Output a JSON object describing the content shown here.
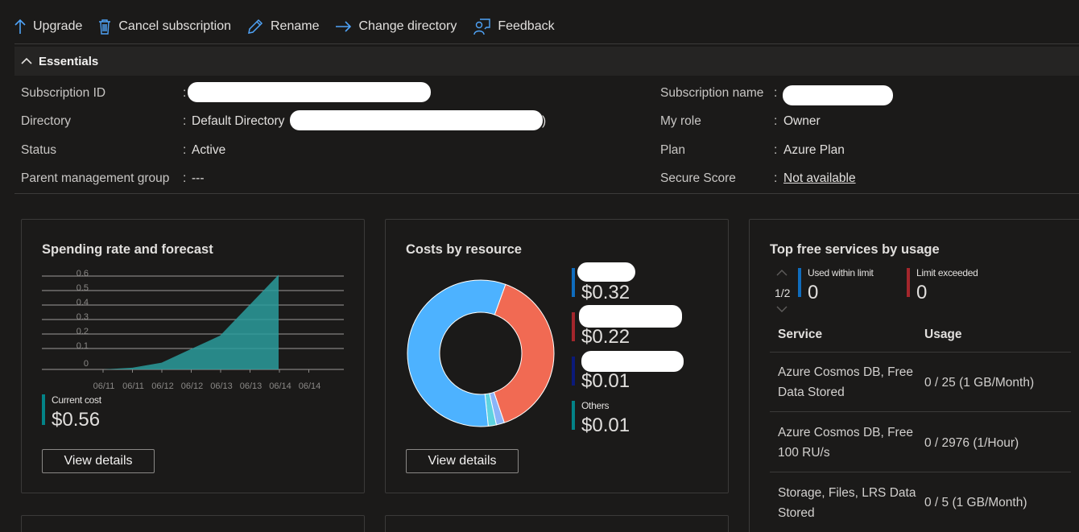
{
  "toolbar": {
    "upgrade": "Upgrade",
    "cancel": "Cancel subscription",
    "rename": "Rename",
    "change_directory": "Change directory",
    "feedback": "Feedback"
  },
  "essentials": {
    "title": "Essentials",
    "left": [
      {
        "key": "Subscription ID",
        "value": ""
      },
      {
        "key": "Directory",
        "value": "Default Directory",
        "suffix": ")"
      },
      {
        "key": "Status",
        "value": "Active"
      },
      {
        "key": "Parent management group",
        "value": "---"
      }
    ],
    "right": [
      {
        "key": "Subscription name",
        "value": ""
      },
      {
        "key": "My role",
        "value": "Owner"
      },
      {
        "key": "Plan",
        "value": "Azure Plan"
      },
      {
        "key": "Secure Score",
        "value": "Not available"
      }
    ]
  },
  "spending": {
    "title": "Spending rate and forecast",
    "current_cost_label": "Current cost",
    "current_cost": "$0.56",
    "button": "View details"
  },
  "costs": {
    "title": "Costs by resource",
    "legend": [
      {
        "name": "",
        "value": "$0.32",
        "color": "#0f6cbd"
      },
      {
        "name": "",
        "value": "$0.22",
        "color": "#a4262c"
      },
      {
        "name": "",
        "value": "$0.01",
        "color": "#0b1a7a"
      },
      {
        "name": "Others",
        "value": "$0.01",
        "color": "#038387"
      }
    ],
    "button": "View details"
  },
  "free_services": {
    "title": "Top free services by usage",
    "pager": "1/2",
    "used_label": "Used within limit",
    "used_value": "0",
    "exceeded_label": "Limit exceeded",
    "exceeded_value": "0",
    "col_service": "Service",
    "col_usage": "Usage",
    "rows": [
      {
        "service_line1": "Azure Cosmos DB, Free",
        "service_line2": "Data Stored",
        "usage": "0 / 25 (1 GB/Month)"
      },
      {
        "service_line1": "Azure Cosmos DB, Free",
        "service_line2": "100 RU/s",
        "usage": "0 / 2976 (1/Hour)"
      },
      {
        "service_line1": "Storage, Files, LRS Data",
        "service_line2": "Stored",
        "usage": "0 / 5 (1 GB/Month)"
      }
    ]
  },
  "chart_data": [
    {
      "type": "area",
      "title": "Spending rate and forecast",
      "x": [
        "06/11",
        "06/11",
        "06/12",
        "06/12",
        "06/13",
        "06/13",
        "06/14",
        "06/14"
      ],
      "y_ticks": [
        "0",
        "0.1",
        "0.2",
        "0.3",
        "0.4",
        "0.5",
        "0.6"
      ],
      "ylim": [
        0,
        0.6
      ],
      "series": [
        {
          "name": "Current cost",
          "values": [
            0,
            0.01,
            0.04,
            0.12,
            0.2,
            0.38,
            0.56
          ],
          "color": "#2a9c9c"
        }
      ]
    },
    {
      "type": "pie",
      "title": "Costs by resource",
      "values": [
        0.32,
        0.22,
        0.01,
        0.01
      ],
      "colors": [
        "#4db2ff",
        "#f16a53",
        "#8ab4f8",
        "#5fd3e0"
      ]
    }
  ],
  "colors": {
    "accent": "#4fa3f7",
    "teal": "#038387",
    "background": "#1b1a19"
  }
}
